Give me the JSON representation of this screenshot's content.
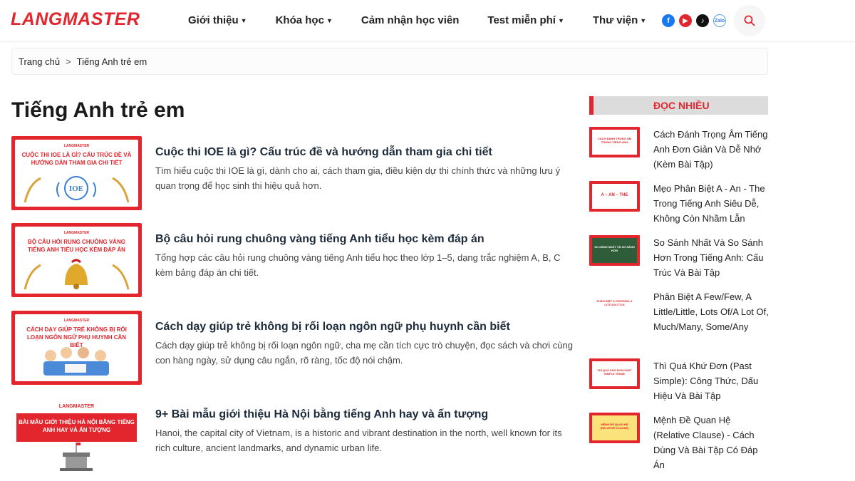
{
  "header": {
    "logo": "LANGMASTER",
    "nav": [
      {
        "label": "Giới thiệu",
        "dropdown": true
      },
      {
        "label": "Khóa học",
        "dropdown": true
      },
      {
        "label": "Cảm nhận học viên",
        "dropdown": false
      },
      {
        "label": "Test miễn phí",
        "dropdown": true
      },
      {
        "label": "Thư viện",
        "dropdown": true
      }
    ],
    "socials": [
      {
        "icon": "facebook-icon",
        "glyph": "f"
      },
      {
        "icon": "youtube-icon",
        "glyph": "▶"
      },
      {
        "icon": "tiktok-icon",
        "glyph": "♪"
      },
      {
        "icon": "zalo-icon",
        "glyph": "Zalo"
      }
    ],
    "accent": "#e3262d"
  },
  "breadcrumb": {
    "home": "Trang chủ",
    "separator": ">",
    "current": "Tiếng Anh trẻ em"
  },
  "main": {
    "title": "Tiếng Anh trẻ em",
    "articles": [
      {
        "title": "Cuộc thi IOE là gì? Cấu trúc đề và hướng dẫn tham gia chi tiết",
        "desc": "Tìm hiểu cuộc thi IOE là gì, dành cho ai, cách tham gia, điều kiện dự thi chính thức và những lưu ý quan trọng để học sinh thi hiệu quả hơn.",
        "thumb_brand": "LANGMASTER",
        "thumb_text": "CUỘC THI IOE LÀ GÌ? CẤU TRÚC ĐỀ VÀ HƯỚNG DẪN THAM GIA CHI TIẾT",
        "thumb_badge": "IOE"
      },
      {
        "title": "Bộ câu hỏi rung chuông vàng tiếng Anh tiểu học kèm đáp án",
        "desc": "Tổng hợp các câu hỏi rung chuông vàng tiếng Anh tiểu học theo lớp 1–5, dạng trắc nghiệm A, B, C kèm bảng đáp án chi tiết.",
        "thumb_brand": "LANGMASTER",
        "thumb_text": "BỘ CÂU HỎI RUNG CHUÔNG VÀNG TIẾNG ANH TIỂU HỌC KÈM ĐÁP ÁN",
        "thumb_badge": ""
      },
      {
        "title": "Cách dạy giúp trẻ không bị rối loạn ngôn ngữ phụ huynh cần biết",
        "desc": "Cách dạy giúp trẻ không bị rối loạn ngôn ngữ, cha mẹ cần tích cực trò chuyện, đọc sách và chơi cùng con hàng ngày, sử dụng câu ngắn, rõ ràng, tốc độ nói chậm.",
        "thumb_brand": "LANGMASTER",
        "thumb_text": "CÁCH DẠY GIÚP TRẺ KHÔNG BỊ RỐI LOẠN NGÔN NGỮ PHỤ HUYNH CẦN BIẾT",
        "thumb_badge": ""
      },
      {
        "title": "9+ Bài mẫu giới thiệu Hà Nội bằng tiếng Anh hay và ấn tượng",
        "desc": "Hanoi, the capital city of Vietnam, is a historic and vibrant destination in the north, well known for its rich culture, ancient landmarks, and dynamic urban life.",
        "thumb_brand": "LANGMASTER",
        "thumb_text": "BÀI MẪU GIỚI THIỆU HÀ NỘI BẰNG TIẾNG ANH HAY VÀ ẤN TƯỢNG",
        "thumb_badge": ""
      }
    ]
  },
  "sidebar": {
    "heading": "ĐỌC NHIỀU",
    "items": [
      {
        "title": "Cách Đánh Trọng Âm Tiếng Anh Đơn Giản Và Dễ Nhớ (Kèm Bài Tập)",
        "thumb_text": "CÁCH ĐÁNH TRỌNG ÂM TRONG TIẾNG ANH"
      },
      {
        "title": "Mẹo Phân Biệt A - An - The Trong Tiếng Anh Siêu Dễ, Không Còn Nhầm Lẫn",
        "thumb_text": "A – AN – THE"
      },
      {
        "title": "So Sánh Nhất Và So Sánh Hơn Trong Tiếng Anh: Cấu Trúc Và Bài Tập",
        "thumb_text": "SO SÁNH NHẤT VÀ SO SÁNH HƠN"
      },
      {
        "title": "Phân Biệt A Few/Few, A Little/Little, Lots Of/A Lot Of, Much/Many, Some/Any",
        "thumb_text": "PHÂN BIỆT A FEW/FEW, A LITTLE/LITTLE"
      },
      {
        "title": "Thì Quá Khứ Đơn (Past Simple): Công Thức, Dấu Hiệu Và Bài Tập",
        "thumb_text": "THÌ QUÁ KHỨ ĐƠN PAST SIMPLE TENSE"
      },
      {
        "title": "Mệnh Đề Quan Hệ (Relative Clause) - Cách Dùng Và Bài Tập Có Đáp Án",
        "thumb_text": "MỆNH ĐỀ QUAN HỆ (RELATIVE CLAUSE)"
      }
    ]
  }
}
